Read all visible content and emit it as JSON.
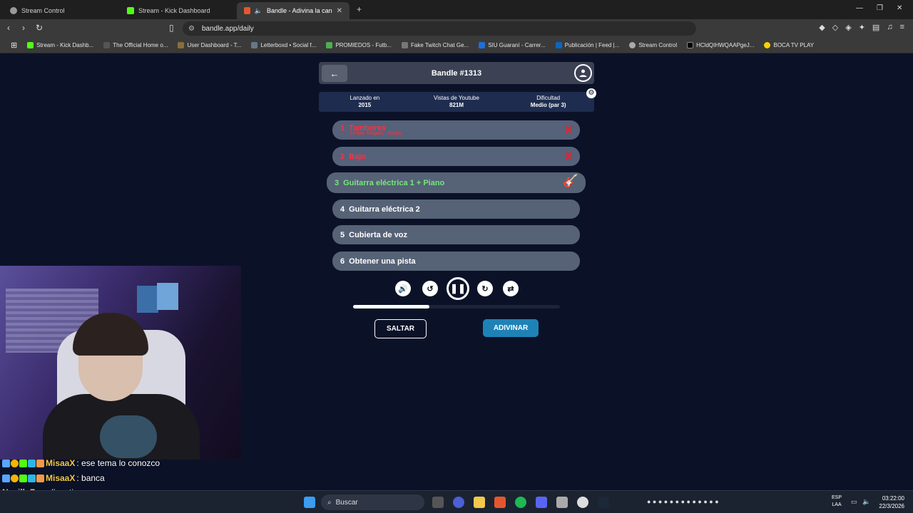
{
  "browser": {
    "tabs": [
      {
        "title": "Stream Control",
        "color": "#aaaaaa"
      },
      {
        "title": "Stream - Kick Dashboard",
        "color": "#53fc18"
      },
      {
        "title": "Bandle - Adivina la canción, u",
        "color": "#e4572e"
      }
    ],
    "url": "bandle.app/daily",
    "bookmarks": [
      {
        "label": "Stream - Kick Dashb...",
        "color": "#53fc18"
      },
      {
        "label": "The Official Home o...",
        "color": "#2e2e2e"
      },
      {
        "label": "User Dashboard - T...",
        "color": "#8b6d3a"
      },
      {
        "label": "Letterboxd • Social f...",
        "color": "#556677"
      },
      {
        "label": "PROMIEDOS - Futb...",
        "color": "#4caf50"
      },
      {
        "label": "Fake Twitch Chat Ge...",
        "color": "#777777"
      },
      {
        "label": "SIU Guaraní - Carrer...",
        "color": "#1e6fd9"
      },
      {
        "label": "Publicación | Feed |...",
        "color": "#0a66c2"
      },
      {
        "label": "Stream Control",
        "color": "#aaaaaa"
      },
      {
        "label": "HCldQIHWQAAPgeJ...",
        "color": "#000000"
      },
      {
        "label": "BOCA TV PLAY",
        "color": "#f5d300"
      }
    ]
  },
  "game": {
    "title": "Bandle #1313",
    "info": [
      {
        "label": "Lanzado en",
        "value": "2015"
      },
      {
        "label": "Vistas de Youtube",
        "value": "821M"
      },
      {
        "label": "Dificultad",
        "value": "Medio (par 3)"
      }
    ],
    "tracks": [
      {
        "num": "1",
        "label": "Tambores",
        "sub": "Simple Shapes - Studio",
        "status": "fail"
      },
      {
        "num": "2",
        "label": "Bajo",
        "sub": "",
        "status": "fail"
      },
      {
        "num": "3",
        "label": "Guitarra eléctrica 1 + Piano",
        "status": "active"
      },
      {
        "num": "4",
        "label": "Guitarra eléctrica 2",
        "status": "pending"
      },
      {
        "num": "5",
        "label": "Cubierta de voz",
        "status": "pending"
      },
      {
        "num": "6",
        "label": "Obtener una pista",
        "status": "pending"
      }
    ],
    "progress": 0.37,
    "buttons": {
      "skip": "SALTAR",
      "guess": "ADIVINAR"
    }
  },
  "chat": [
    {
      "user": "MisaaX",
      "message": ": ese tema lo conozco",
      "color": "#f2c94c",
      "badges": true
    },
    {
      "user": "MisaaX",
      "message": ": banca",
      "color": "#f2c94c",
      "badges": true
    },
    {
      "user": "NevilleZ",
      "message": ": radioactive",
      "color": "#f2c94c",
      "badges": false
    }
  ],
  "taskbar": {
    "search": "Buscar",
    "lang": [
      "ESP",
      "LAA"
    ],
    "time": "03:22:00",
    "date": "22/3/2026"
  }
}
